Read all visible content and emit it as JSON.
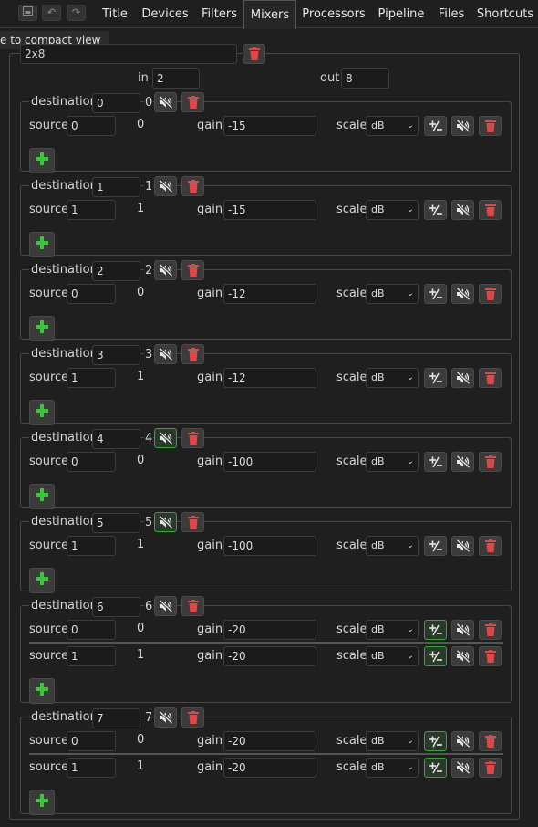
{
  "toolbar": {
    "icons": [
      "compact-view-icon",
      "undo-icon",
      "redo-icon"
    ]
  },
  "tabs": [
    "Title",
    "Devices",
    "Filters",
    "Mixers",
    "Processors",
    "Pipeline",
    "Files",
    "Shortcuts"
  ],
  "active_tab": "Mixers",
  "tooltip": "e to compact view",
  "mixer": {
    "name": "2x8",
    "in_label": "in",
    "in_value": "2",
    "out_label": "out",
    "out_value": "8"
  },
  "labels": {
    "destination": "destination",
    "source": "source",
    "gain": "gain",
    "scale": "scale"
  },
  "destinations": [
    {
      "dest": "0",
      "num": "0",
      "muted": false,
      "sources": [
        {
          "ch": "0",
          "num": "0",
          "gain": "-15",
          "scale": "dB",
          "inverted": false
        }
      ]
    },
    {
      "dest": "1",
      "num": "1",
      "muted": false,
      "sources": [
        {
          "ch": "1",
          "num": "1",
          "gain": "-15",
          "scale": "dB",
          "inverted": false
        }
      ]
    },
    {
      "dest": "2",
      "num": "2",
      "muted": false,
      "sources": [
        {
          "ch": "0",
          "num": "0",
          "gain": "-12",
          "scale": "dB",
          "inverted": false
        }
      ]
    },
    {
      "dest": "3",
      "num": "3",
      "muted": false,
      "sources": [
        {
          "ch": "1",
          "num": "1",
          "gain": "-12",
          "scale": "dB",
          "inverted": false
        }
      ]
    },
    {
      "dest": "4",
      "num": "4",
      "muted": true,
      "sources": [
        {
          "ch": "0",
          "num": "0",
          "gain": "-100",
          "scale": "dB",
          "inverted": false
        }
      ]
    },
    {
      "dest": "5",
      "num": "5",
      "muted": true,
      "sources": [
        {
          "ch": "1",
          "num": "1",
          "gain": "-100",
          "scale": "dB",
          "inverted": false
        }
      ]
    },
    {
      "dest": "6",
      "num": "6",
      "muted": false,
      "sources": [
        {
          "ch": "0",
          "num": "0",
          "gain": "-20",
          "scale": "dB",
          "inverted": true
        },
        {
          "ch": "1",
          "num": "1",
          "gain": "-20",
          "scale": "dB",
          "inverted": true
        }
      ]
    },
    {
      "dest": "7",
      "num": "7",
      "muted": false,
      "sources": [
        {
          "ch": "0",
          "num": "0",
          "gain": "-20",
          "scale": "dB",
          "inverted": true
        },
        {
          "ch": "1",
          "num": "1",
          "gain": "-20",
          "scale": "dB",
          "inverted": true
        }
      ]
    }
  ],
  "colors": {
    "accent_green": "#2faa2f",
    "delete_red": "#e04848"
  }
}
